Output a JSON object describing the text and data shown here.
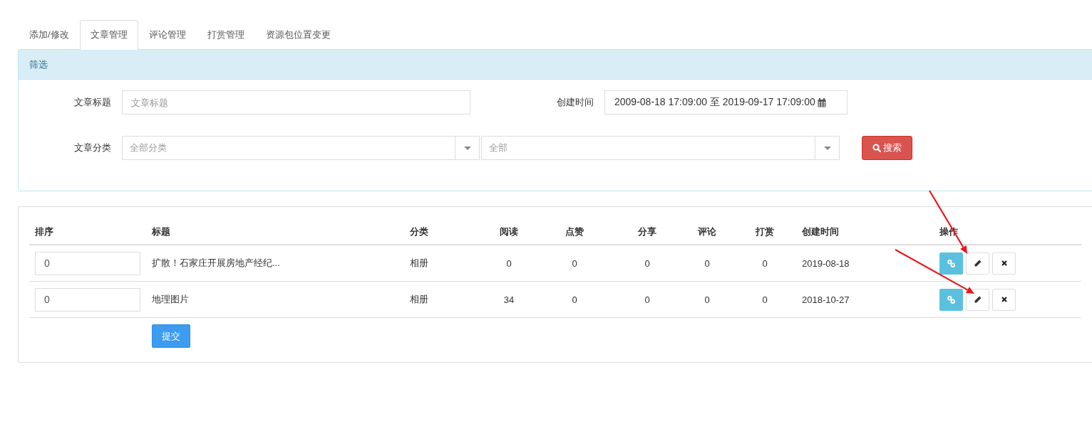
{
  "tabs": [
    {
      "label": "添加/修改",
      "selected": false
    },
    {
      "label": "文章管理",
      "selected": true
    },
    {
      "label": "评论管理",
      "selected": false
    },
    {
      "label": "打赏管理",
      "selected": false
    },
    {
      "label": "资源包位置变更",
      "selected": false
    }
  ],
  "filter": {
    "title": "筛选",
    "title_field": {
      "label": "文章标题",
      "placeholder": "文章标题"
    },
    "date_field": {
      "label": "创建时间",
      "value": "2009-08-18 17:09:00 至 2019-09-17 17:09:00"
    },
    "category_field": {
      "label": "文章分类",
      "selects": [
        {
          "placeholder": "全部分类"
        },
        {
          "placeholder": "全部"
        }
      ]
    },
    "search_button": "搜索"
  },
  "table": {
    "columns": [
      "排序",
      "标题",
      "分类",
      "阅读",
      "点赞",
      "分享",
      "评论",
      "打赏",
      "创建时间",
      "操作"
    ],
    "rows": [
      {
        "cells": [
          "0",
          "扩散！石家庄开展房地产经纪...",
          "相册",
          "0",
          "0",
          "0",
          "0",
          "0",
          "2019-08-18"
        ]
      },
      {
        "cells": [
          "0",
          "地理图片",
          "相册",
          "34",
          "0",
          "0",
          "0",
          "0",
          "2018-10-27"
        ]
      }
    ],
    "submit_button": "提交"
  }
}
